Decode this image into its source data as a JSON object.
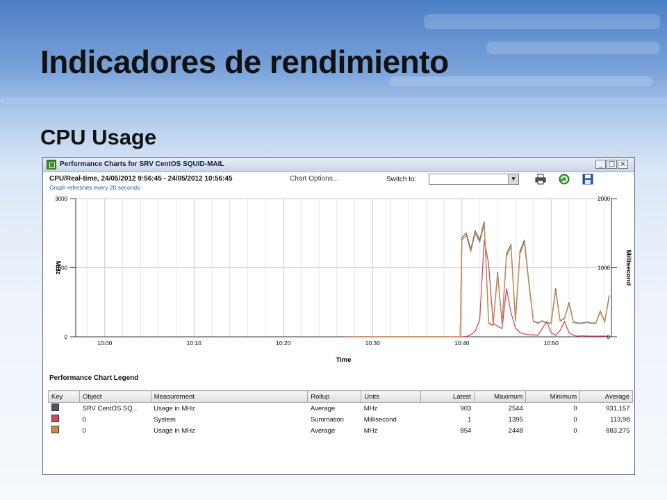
{
  "slide": {
    "title": "Indicadores de rendimiento",
    "subtitle": "CPU Usage"
  },
  "window": {
    "title": "Performance Charts for SRV CentOS SQUID-MAIL",
    "buttons": [
      "_",
      "□",
      "×"
    ]
  },
  "toolbar": {
    "range": "CPU/Real-time, 24/05/2012 9:56:45 - 24/05/2012 10:56:45",
    "chart_options": "Chart Options...",
    "refresh_note": "Graph refreshes every 20 seconds",
    "switch_label": "Switch to:",
    "switch_value": "",
    "icons": [
      "print-icon",
      "refresh-icon",
      "save-icon"
    ]
  },
  "chart_data": {
    "type": "line",
    "xlabel": "Time",
    "ylabel": "MHz",
    "ylabel_right": "Millisecond",
    "x_ticks": [
      "10:00",
      "10:10",
      "10:20",
      "10:30",
      "10:40",
      "10:50"
    ],
    "ylim": [
      0,
      3000
    ],
    "ylim_right": [
      0,
      2000
    ],
    "y_ticks": [
      "0",
      "1500",
      "3000"
    ],
    "y_ticks_right": [
      "0",
      "1000",
      "2000"
    ],
    "grid": true,
    "x_minutes": [
      27,
      39.8,
      40,
      40.5,
      41,
      41.5,
      42,
      42.5,
      43,
      43.5,
      44,
      44.5,
      45,
      45.5,
      46,
      46.5,
      47,
      47.5,
      48,
      48.5,
      49,
      49.5,
      50,
      50.5,
      51,
      51.5,
      52,
      52.5,
      53,
      53.5,
      54,
      54.5,
      55,
      55.5,
      56,
      56.5
    ],
    "series": [
      {
        "color": "#5a6a7a",
        "axis": "left",
        "values": [
          0,
          0,
          2150,
          2250,
          1900,
          2300,
          2100,
          2500,
          300,
          250,
          1400,
          300,
          1800,
          2000,
          350,
          1850,
          2100,
          1200,
          350,
          300,
          350,
          300,
          300,
          1050,
          350,
          400,
          750,
          320,
          300,
          300,
          320,
          300,
          300,
          560,
          330,
          900
        ]
      },
      {
        "color": "#d4485e",
        "axis": "right",
        "values": [
          0,
          0,
          0,
          5,
          30,
          80,
          250,
          1400,
          1050,
          200,
          150,
          120,
          700,
          350,
          130,
          60,
          40,
          30,
          30,
          20,
          120,
          220,
          60,
          20,
          90,
          220,
          60,
          20,
          10,
          15,
          10,
          10,
          10,
          10,
          10,
          5
        ]
      },
      {
        "color": "#c8894a",
        "axis": "left",
        "values": [
          0,
          0,
          2100,
          2200,
          1850,
          2250,
          2050,
          2448,
          290,
          240,
          1350,
          290,
          1750,
          1950,
          340,
          1800,
          2050,
          1150,
          340,
          290,
          340,
          290,
          290,
          1000,
          340,
          390,
          720,
          310,
          290,
          290,
          310,
          290,
          290,
          540,
          320,
          854
        ]
      }
    ]
  },
  "legend": {
    "title": "Performance Chart Legend",
    "columns": [
      "Key",
      "Object",
      "Measurement",
      "Rollup",
      "Units",
      "Latest",
      "Maximum",
      "Minimum",
      "Average"
    ],
    "rows": [
      {
        "key_color": "#4a5566",
        "object": "SRV CentOS SQ...",
        "measurement": "Usage in MHz",
        "rollup": "Average",
        "units": "MHz",
        "latest": "903",
        "maximum": "2544",
        "minimum": "0",
        "average": "931,157"
      },
      {
        "key_color": "#d4485e",
        "object": "0",
        "measurement": "System",
        "rollup": "Summation",
        "units": "Millisecond",
        "latest": "1",
        "maximum": "1395",
        "minimum": "0",
        "average": "113,98"
      },
      {
        "key_color": "#c8894a",
        "object": "0",
        "measurement": "Usage in MHz",
        "rollup": "Average",
        "units": "MHz",
        "latest": "854",
        "maximum": "2448",
        "minimum": "0",
        "average": "883,275"
      }
    ]
  }
}
